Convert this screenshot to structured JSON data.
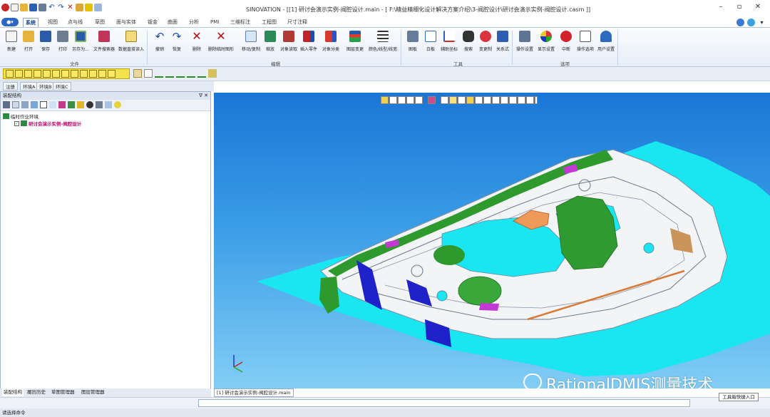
{
  "app": {
    "title": "SINOVATION - [[1] 研讨会演示实例-阀腔设计.main - [ F:\\精益精细化设计解决方案介绍\\3-阀腔设计\\研讨会演示实例-阀腔设计.casm ]]"
  },
  "tabs": [
    {
      "label": "系统",
      "active": true
    },
    {
      "label": "视图"
    },
    {
      "label": "点与线"
    },
    {
      "label": "草图"
    },
    {
      "label": "面与实体"
    },
    {
      "label": "钣金"
    },
    {
      "label": "曲面"
    },
    {
      "label": "分析"
    },
    {
      "label": "PMI"
    },
    {
      "label": "三维标注"
    },
    {
      "label": "工程图"
    },
    {
      "label": "尺寸注释"
    }
  ],
  "ribbon": {
    "file_buttons": [
      "新建",
      "打开",
      "保存",
      "打印",
      "另存为...",
      "文件搜索器",
      "数据直接读入"
    ],
    "edit_buttons": [
      "撤销",
      "恢复",
      "删除",
      "删除临时图形",
      "移动/复制",
      "缩放",
      "对象读取",
      "插入零件",
      "对象分类",
      "图层变更",
      "颜色/线型/线宽"
    ],
    "tool_buttons": [
      "图板",
      "白板",
      "辅助坐标",
      "搜索",
      "变更制",
      "关系式"
    ],
    "option_buttons": [
      "操作设置",
      "显示设置",
      "中断",
      "操作选项",
      "用户设置"
    ],
    "groups": {
      "file": "文件",
      "edit": "编辑",
      "tools": "工具",
      "options": "选项"
    }
  },
  "env_tabs": [
    "注册",
    "环境A",
    "环境B",
    "环境C"
  ],
  "left_panel": {
    "header": "装配结构",
    "tree": [
      {
        "label": "临时作业环境",
        "level": 0,
        "color": "#222222"
      },
      {
        "label": "研讨会演示实例-阀腔设计",
        "level": 1,
        "color": "#c0006c"
      }
    ],
    "bottom_tabs": [
      "装配结构",
      "履历历史",
      "草图管理器",
      "图层管理器"
    ]
  },
  "document_tab": "[1] 研讨会演示实例-阀腔设计.main",
  "tooltip": "工具箱快捷入口",
  "status": "请选择命令",
  "watermark": "RationalDMIS测量技术",
  "colors": {
    "ribbon_accent": "#2b66c4",
    "viewport_top": "#1a76d6",
    "viewport_bottom": "#82cdf5",
    "part_cyan": "#19e6f0",
    "part_green": "#2e9a2e",
    "part_blue": "#1e22c8"
  }
}
